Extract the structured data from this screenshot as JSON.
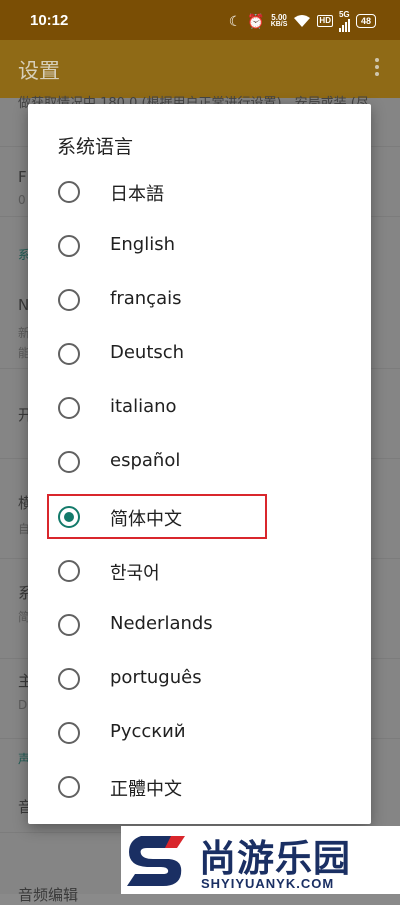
{
  "status_bar": {
    "time": "10:12",
    "speed_value": "5.00",
    "speed_unit": "KB/S",
    "hd": "HD",
    "signal_label": "5G",
    "battery": "48"
  },
  "app_bar": {
    "title": "设置"
  },
  "background": {
    "row1_text": "做获取情况中 180 0 (根据用户正常进行设置)，安局或装 (尽",
    "row2_title": "F",
    "row2_sub": "0",
    "section1": "系",
    "row3_title": "N",
    "row3_sub1": "新",
    "row3_sub2": "能",
    "row4_title": "开",
    "row5_title": "横",
    "row5_sub": "自",
    "row6_title": "系",
    "row6_sub": "简",
    "row7_title": "主",
    "row7_sub": "D",
    "section2": "声",
    "row8_title": "音",
    "row9_title": "音频编辑"
  },
  "dialog": {
    "title": "系统语言",
    "options": [
      {
        "label": "日本語",
        "checked": false
      },
      {
        "label": "English",
        "checked": false
      },
      {
        "label": "français",
        "checked": false
      },
      {
        "label": "Deutsch",
        "checked": false
      },
      {
        "label": "italiano",
        "checked": false
      },
      {
        "label": "español",
        "checked": false
      },
      {
        "label": "简体中文",
        "checked": true
      },
      {
        "label": "한국어",
        "checked": false
      },
      {
        "label": "Nederlands",
        "checked": false
      },
      {
        "label": "português",
        "checked": false
      },
      {
        "label": "Русский",
        "checked": false
      },
      {
        "label": "正體中文",
        "checked": false
      }
    ]
  },
  "watermark": {
    "name": "尚游乐园",
    "url": "SHYIYUANYK.COM"
  },
  "colors": {
    "accent": "#137a6a",
    "highlight": "#d9262c",
    "brand": "#1a2f63",
    "statusbar": "#7a4e05",
    "appbar": "#8f6a16"
  }
}
